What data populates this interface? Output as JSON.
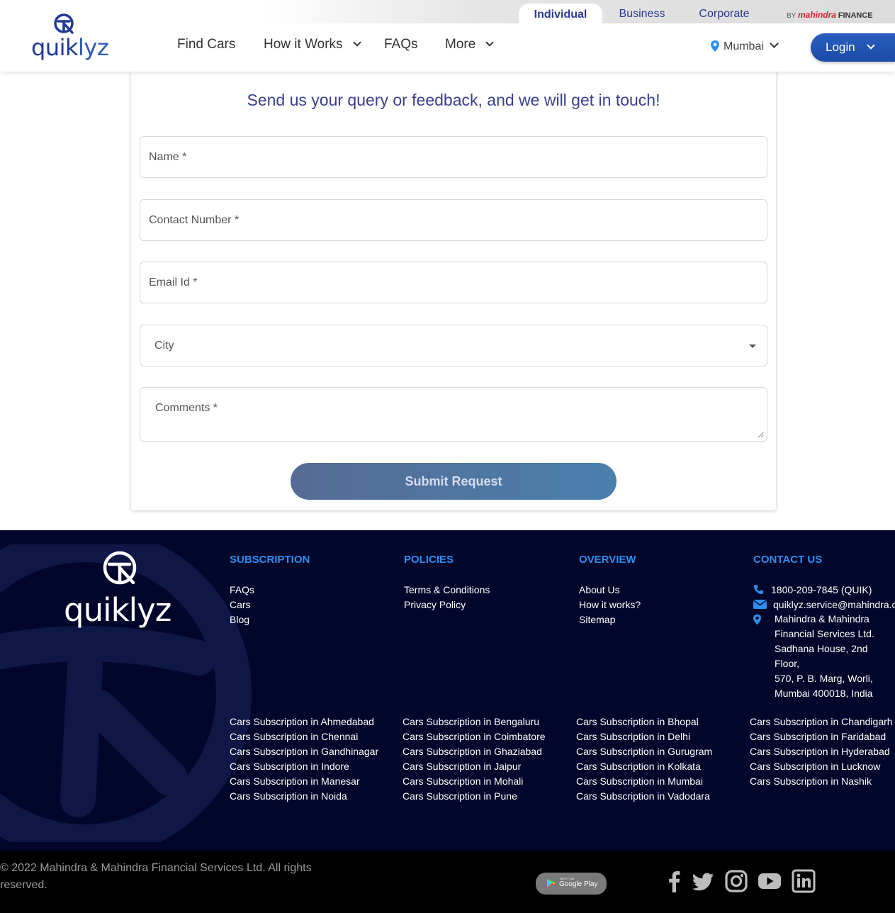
{
  "header": {
    "segments": [
      "Individual",
      "Business",
      "Corporate"
    ],
    "byline": {
      "by": "BY",
      "brand": "mahindra",
      "finance": "FINANCE"
    },
    "logo_text": {
      "part1": "quik",
      "part2": "lyz"
    },
    "nav": {
      "find_cars": "Find Cars",
      "how_it_works": "How it Works",
      "faqs": "FAQs",
      "more": "More"
    },
    "city": "Mumbai",
    "login": "Login"
  },
  "form": {
    "title": "Send us your query or feedback, and we will get in touch!",
    "name_placeholder": "Name *",
    "contact_placeholder": "Contact Number *",
    "email_placeholder": "Email Id *",
    "city_label": "City",
    "comments_placeholder": "Comments *",
    "submit": "Submit Request"
  },
  "footer": {
    "logo_text": "quiklyz",
    "subscription": {
      "heading": "SUBSCRIPTION",
      "links": [
        "FAQs",
        "Cars",
        "Blog"
      ]
    },
    "policies": {
      "heading": "POLICIES",
      "links": [
        "Terms & Conditions",
        "Privacy Policy"
      ]
    },
    "overview": {
      "heading": "OVERVIEW",
      "links": [
        "About Us",
        "How it works?",
        "Sitemap"
      ]
    },
    "contact": {
      "heading": "CONTACT US",
      "phone": "1800-209-7845 (QUIK)",
      "email": "quiklyz.service@mahindra.com",
      "address": [
        "Mahindra & Mahindra",
        "Financial Services Ltd.",
        "Sadhana House, 2nd Floor,",
        "570, P. B. Marg, Worli,",
        "Mumbai 400018, India"
      ]
    },
    "city_links": [
      [
        "Cars Subscription in Ahmedabad",
        "Cars Subscription in Chennai",
        "Cars Subscription in Gandhinagar",
        "Cars Subscription in Indore",
        "Cars Subscription in Manesar",
        "Cars Subscription in Noida"
      ],
      [
        "Cars Subscription in Bengaluru",
        "Cars Subscription in Coimbatore",
        "Cars Subscription in Ghaziabad",
        "Cars Subscription in Jaipur",
        "Cars Subscription in Mohali",
        "Cars Subscription in Pune"
      ],
      [
        "Cars Subscription in Bhopal",
        "Cars Subscription in Delhi",
        "Cars Subscription in Gurugram",
        "Cars Subscription in Kolkata",
        "Cars Subscription in Mumbai",
        "Cars Subscription in Vadodara"
      ],
      [
        "Cars Subscription in Chandigarh",
        "Cars Subscription in Faridabad",
        "Cars Subscription in Hyderabad",
        "Cars Subscription in Lucknow",
        "Cars Subscription in Nashik"
      ]
    ]
  },
  "bottom": {
    "copyright": "© 2022 Mahindra & Mahindra Financial Services Ltd. All rights reserved.",
    "gplay_small": "GET IT ON",
    "gplay_big": "Google Play",
    "social_icons": [
      "facebook-icon",
      "twitter-icon",
      "instagram-icon",
      "youtube-icon",
      "linkedin-icon"
    ]
  },
  "colors": {
    "brand_blue": "#1f3a93",
    "footer_bg": "#02062a",
    "footer_heading": "#2a8ff0",
    "login_bg": "#1b4aa6"
  }
}
